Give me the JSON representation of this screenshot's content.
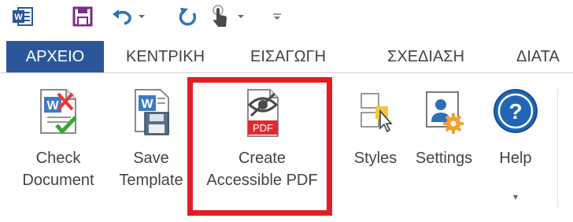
{
  "quick_access": {
    "icons": [
      "word-app-icon",
      "save-icon",
      "undo-icon",
      "redo-icon",
      "touch-mode-icon",
      "customize-qat-icon"
    ]
  },
  "tabs": {
    "file": "ΑΡΧΕΙΟ",
    "home": "ΚΕΝΤΡΙΚΗ",
    "insert": "ΕΙΣΑΓΩΓΗ",
    "design": "ΣΧΕΔΙΑΣΗ",
    "layout": "ΔΙΑΤΑ"
  },
  "ribbon": {
    "check_document": {
      "line1": "Check",
      "line2": "Document"
    },
    "save_template": {
      "line1": "Save",
      "line2": "Template"
    },
    "create_pdf": {
      "line1": "Create",
      "line2": "Accessible PDF",
      "badge": "PDF"
    },
    "styles": {
      "line1": "Styles"
    },
    "settings": {
      "line1": "Settings"
    },
    "help": {
      "line1": "Help",
      "dropdown": "▾"
    }
  },
  "colors": {
    "file_tab": "#2b579a",
    "highlight": "#e41d24",
    "save_purple": "#7b2b8a",
    "undo_blue": "#2e75b6",
    "help_blue": "#1f66b8",
    "pdf_red": "#e3282e"
  }
}
